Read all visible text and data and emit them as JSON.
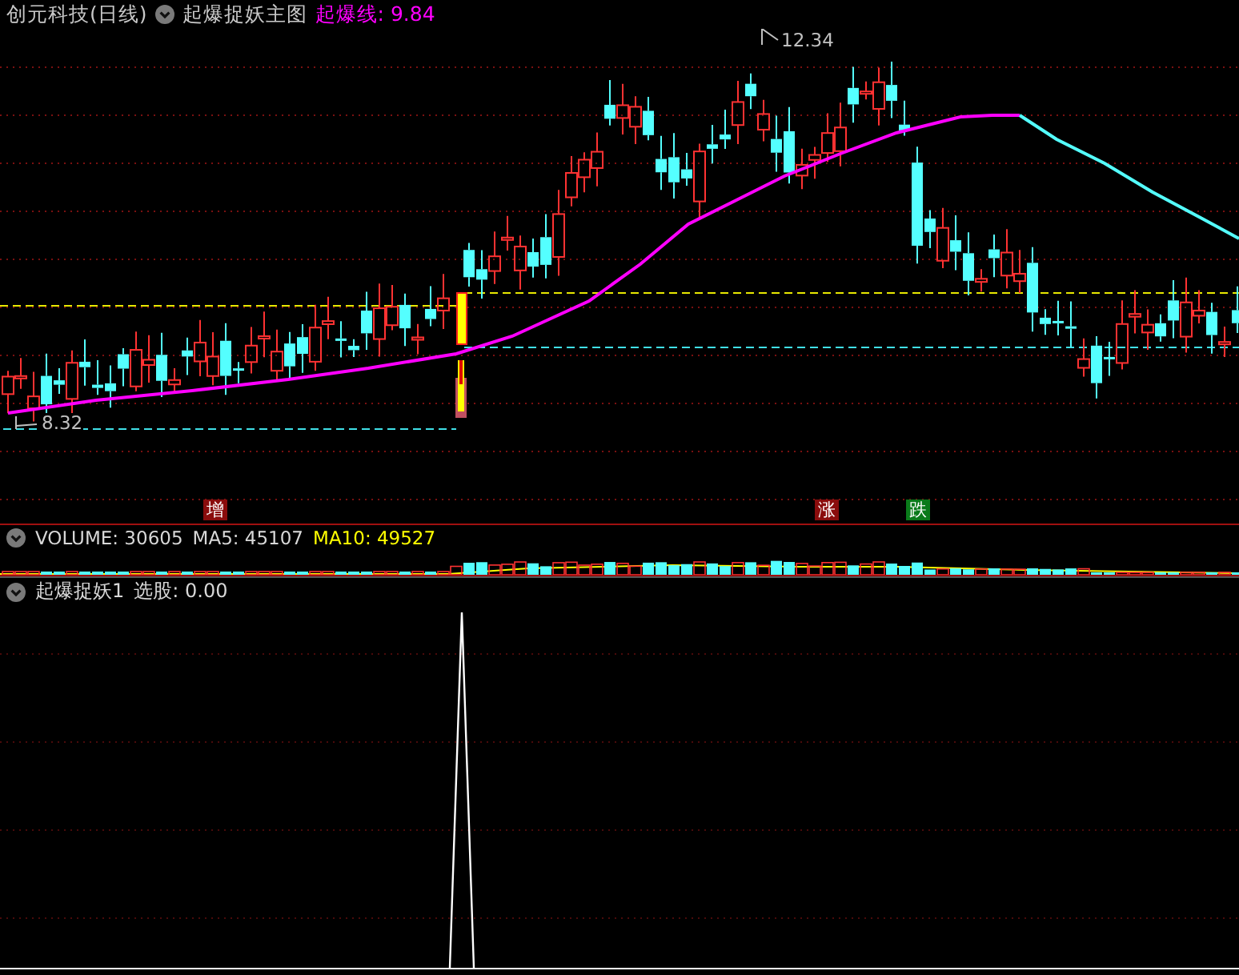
{
  "header": {
    "stock": "创元科技(日线)",
    "indicator": "起爆捉妖主图",
    "line_reading": "起爆线: 9.84"
  },
  "main_chart": {
    "high_label": "12.34",
    "low_label": "8.32",
    "signals": [
      {
        "text": "增",
        "kind": "increase"
      },
      {
        "text": "涨",
        "kind": "rise"
      },
      {
        "text": "跌",
        "kind": "fall"
      }
    ]
  },
  "volume_panel": {
    "volume": "VOLUME: 30605",
    "ma5": "MA5: 45107",
    "ma10": "MA10: 49527"
  },
  "indicator_panel": {
    "name": "起爆捉妖1",
    "reading": "选股: 0.00"
  }
}
